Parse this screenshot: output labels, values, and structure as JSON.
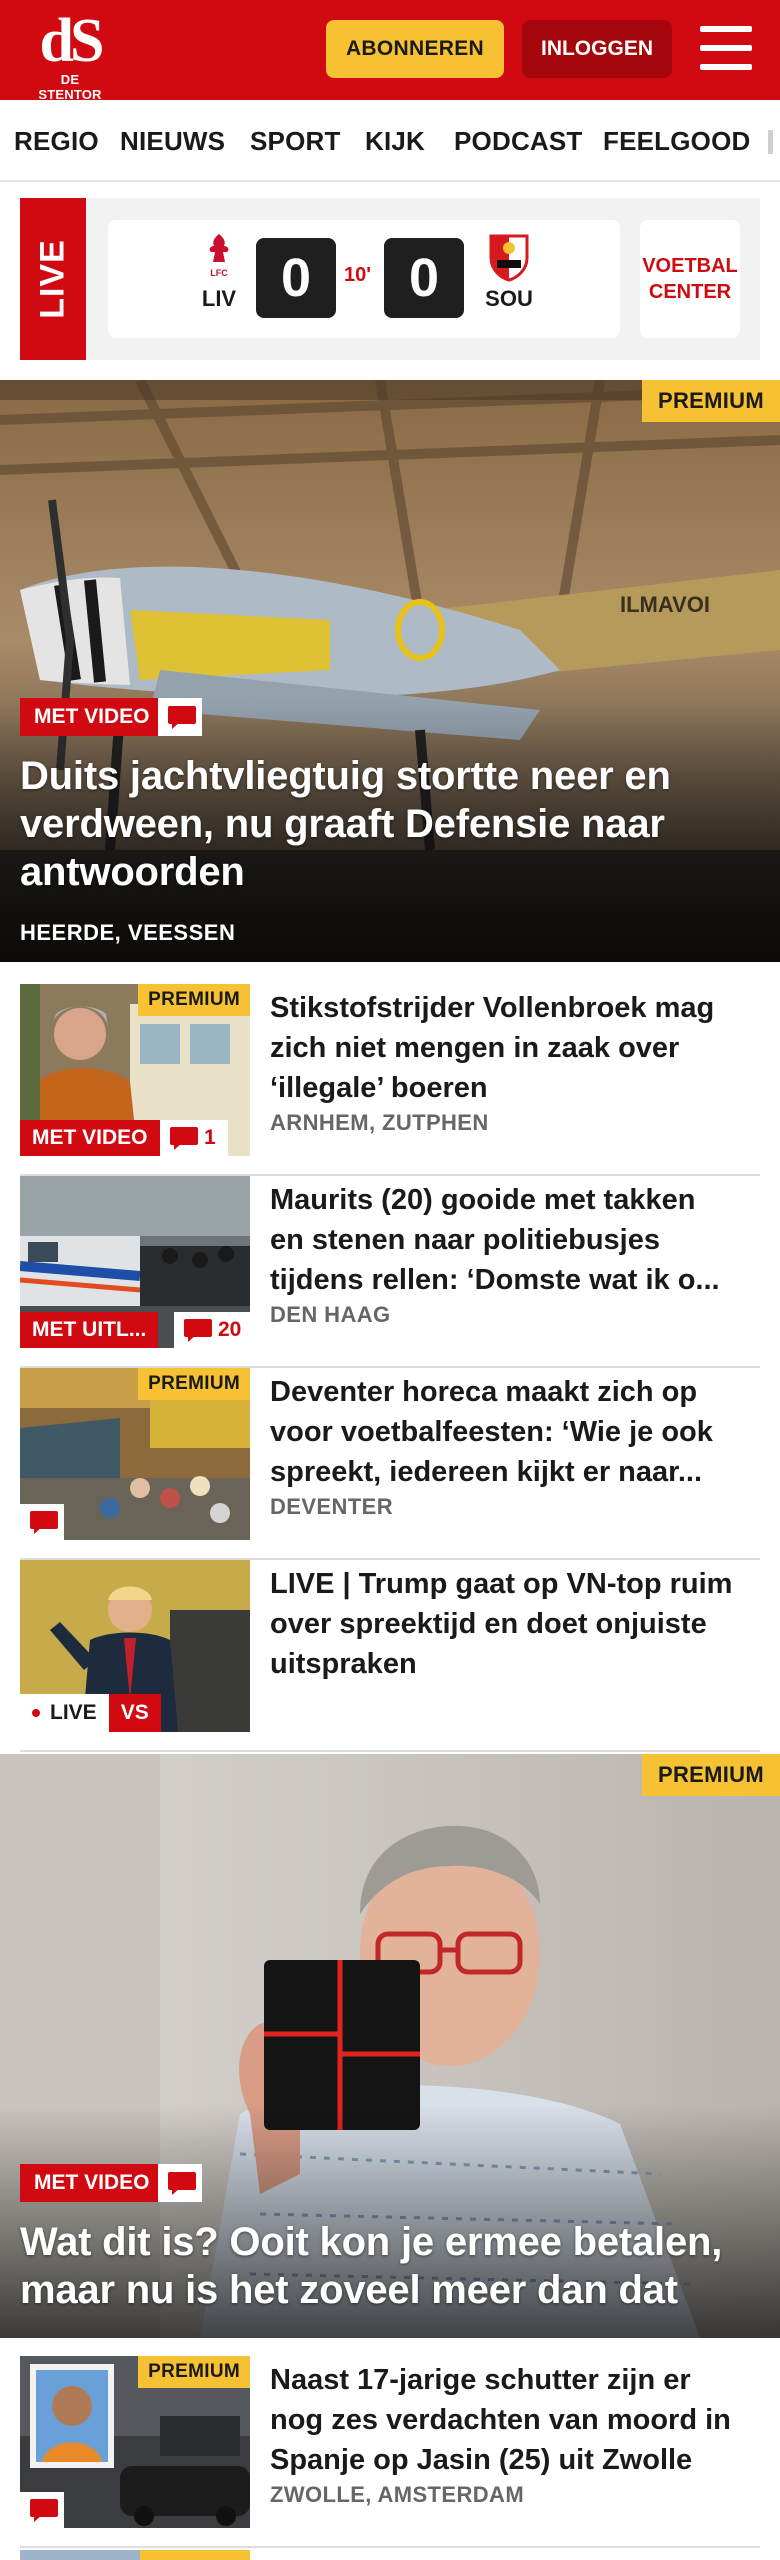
{
  "header": {
    "logo_mark": "dS",
    "logo_name": "DE STENTOR",
    "subscribe_label": "ABONNEREN",
    "login_label": "INLOGGEN",
    "menu_icon": "hamburger-menu-icon"
  },
  "nav": {
    "items": [
      {
        "label": "REGIO"
      },
      {
        "label": "NIEUWS"
      },
      {
        "label": "SPORT"
      },
      {
        "label": "KIJK"
      },
      {
        "label": "PODCAST"
      },
      {
        "label": "FEELGOOD"
      }
    ]
  },
  "live_match": {
    "live_label": "LIVE",
    "home": {
      "abbr": "LIV",
      "score": "0",
      "crest": "liverpool-crest-icon"
    },
    "away": {
      "abbr": "SOU",
      "score": "0",
      "crest": "southampton-crest-icon"
    },
    "minute": "10'",
    "center_label_1": "VOETBAL",
    "center_label_2": "CENTER"
  },
  "hero1": {
    "premium": "PREMIUM",
    "badge": "MET VIDEO",
    "title_1": "Duits jachtvliegtuig stortte neer en",
    "title_2": "verdween, nu graaft Defensie naar",
    "title_3": "antwoorden",
    "location": "HEERDE, VEESSEN"
  },
  "articles": [
    {
      "premium": "PREMIUM",
      "badge": "MET VIDEO",
      "comments": "1",
      "title_1": "Stikstofstrijder Vollenbroek mag",
      "title_2": "zich niet mengen in zaak over",
      "title_3": "‘illegale’ boeren",
      "location": "ARNHEM, ZUTPHEN"
    },
    {
      "badge": "MET UITL...",
      "comments": "20",
      "title_1": "Maurits (20) gooide met takken",
      "title_2": "en stenen naar politiebusjes",
      "title_3": "tijdens rellen: ‘Domste wat ik o...",
      "location": "DEN HAAG"
    },
    {
      "premium": "PREMIUM",
      "title_1": "Deventer horeca maakt zich op",
      "title_2": "voor voetbalfeesten: ‘Wie je ook",
      "title_3": "spreekt, iedereen kijkt er naar...",
      "location": "DEVENTER"
    },
    {
      "live": "LIVE",
      "tag": "VS",
      "title_1": "LIVE | Trump gaat op VN-top ruim",
      "title_2": "over spreektijd en doet onjuiste",
      "title_3": "uitspraken"
    }
  ],
  "hero2": {
    "premium": "PREMIUM",
    "badge": "MET VIDEO",
    "title_1": "Wat dit is? Ooit kon je ermee betalen,",
    "title_2": "maar nu is het zoveel meer dan dat"
  },
  "article5": {
    "premium": "PREMIUM",
    "title_1": "Naast 17-jarige schutter zijn er",
    "title_2": "nog zes verdachten van moord in",
    "title_3": "Spanje op Jasin (25) uit Zwolle",
    "location": "ZWOLLE, AMSTERDAM"
  },
  "colors": {
    "brand_red": "#d10a11",
    "premium_yellow": "#f6c132",
    "login_dark_red": "#a5060c"
  }
}
